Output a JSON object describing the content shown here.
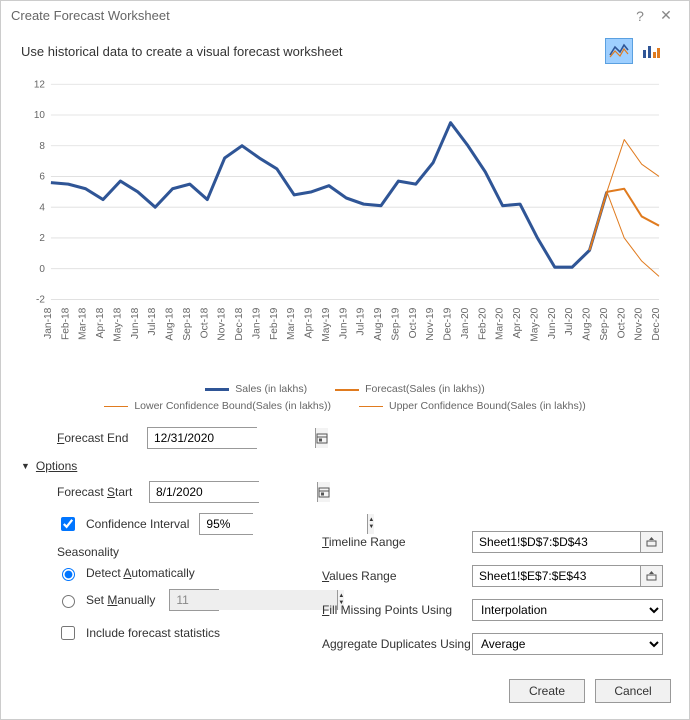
{
  "titlebar": {
    "title": "Create Forecast Worksheet"
  },
  "subtitle": "Use historical data to create a visual forecast worksheet",
  "chart_data": {
    "type": "line",
    "title": "",
    "xlabel": "",
    "ylabel": "",
    "ylim": [
      -2,
      12
    ],
    "categories": [
      "Jan-18",
      "Feb-18",
      "Mar-18",
      "Apr-18",
      "May-18",
      "Jun-18",
      "Jul-18",
      "Aug-18",
      "Sep-18",
      "Oct-18",
      "Nov-18",
      "Dec-18",
      "Jan-19",
      "Feb-19",
      "Mar-19",
      "Apr-19",
      "May-19",
      "Jun-19",
      "Jul-19",
      "Aug-19",
      "Sep-19",
      "Oct-19",
      "Nov-19",
      "Dec-19",
      "Jan-20",
      "Feb-20",
      "Mar-20",
      "Apr-20",
      "May-20",
      "Jun-20",
      "Jul-20",
      "Aug-20",
      "Sep-20",
      "Oct-20",
      "Nov-20",
      "Dec-20"
    ],
    "series": [
      {
        "name": "Sales (in lakhs)",
        "color": "#2f5596",
        "values": [
          5.6,
          5.5,
          5.2,
          4.5,
          5.7,
          5.0,
          4.0,
          5.2,
          5.5,
          4.5,
          7.2,
          8.0,
          7.2,
          6.5,
          4.8,
          5.0,
          5.4,
          4.6,
          4.2,
          4.1,
          5.7,
          5.5,
          6.9,
          9.5,
          8.0,
          6.3,
          4.1,
          4.2,
          2.0,
          0.1,
          0.1,
          1.2,
          5.0,
          null,
          null,
          null
        ]
      },
      {
        "name": "Forecast(Sales (in lakhs))",
        "color": "#e07b1f",
        "values": [
          null,
          null,
          null,
          null,
          null,
          null,
          null,
          null,
          null,
          null,
          null,
          null,
          null,
          null,
          null,
          null,
          null,
          null,
          null,
          null,
          null,
          null,
          null,
          null,
          null,
          null,
          null,
          null,
          null,
          null,
          null,
          1.2,
          5.0,
          5.2,
          3.4,
          2.8
        ]
      },
      {
        "name": "Lower Confidence Bound(Sales (in lakhs))",
        "color": "#e07b1f",
        "values": [
          null,
          null,
          null,
          null,
          null,
          null,
          null,
          null,
          null,
          null,
          null,
          null,
          null,
          null,
          null,
          null,
          null,
          null,
          null,
          null,
          null,
          null,
          null,
          null,
          null,
          null,
          null,
          null,
          null,
          null,
          null,
          1.2,
          5.0,
          2.0,
          0.5,
          -0.5
        ]
      },
      {
        "name": "Upper Confidence Bound(Sales (in lakhs))",
        "color": "#e07b1f",
        "values": [
          null,
          null,
          null,
          null,
          null,
          null,
          null,
          null,
          null,
          null,
          null,
          null,
          null,
          null,
          null,
          null,
          null,
          null,
          null,
          null,
          null,
          null,
          null,
          null,
          null,
          null,
          null,
          null,
          null,
          null,
          null,
          1.2,
          5.0,
          8.4,
          6.8,
          6.0
        ]
      }
    ],
    "yticks": [
      -2,
      0,
      2,
      4,
      6,
      8,
      10,
      12
    ]
  },
  "legend": {
    "sales": "Sales (in lakhs)",
    "forecast": "Forecast(Sales (in lakhs))",
    "lower": "Lower Confidence Bound(Sales (in lakhs))",
    "upper": "Upper Confidence Bound(Sales (in lakhs))"
  },
  "form": {
    "forecast_end_label": "Forecast End",
    "forecast_end_value": "12/31/2020",
    "options_label": "Options",
    "forecast_start_label": "Forecast Start",
    "forecast_start_value": "8/1/2020",
    "confidence_label": "Confidence Interval",
    "confidence_value": "95%",
    "seasonality_label": "Seasonality",
    "detect_auto_label": "Detect Automatically",
    "set_manual_label": "Set Manually",
    "set_manual_value": "11",
    "include_stats_label": "Include forecast statistics",
    "timeline_label": "Timeline Range",
    "timeline_value": "Sheet1!$D$7:$D$43",
    "values_label": "Values Range",
    "values_value": "Sheet1!$E$7:$E$43",
    "fill_label": "Fill Missing Points Using",
    "fill_value": "Interpolation",
    "agg_label": "Aggregate Duplicates Using",
    "agg_value": "Average"
  },
  "footer": {
    "create": "Create",
    "cancel": "Cancel"
  }
}
